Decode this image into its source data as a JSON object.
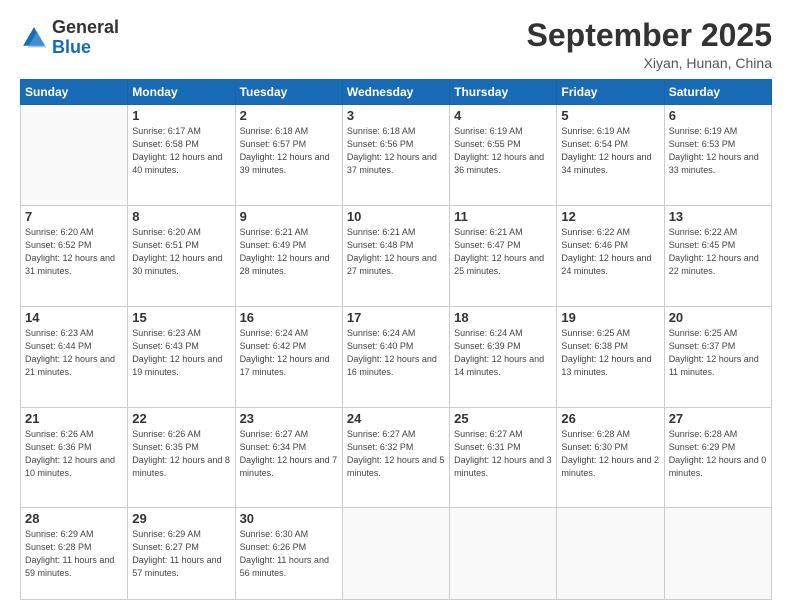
{
  "logo": {
    "general": "General",
    "blue": "Blue"
  },
  "header": {
    "month": "September 2025",
    "location": "Xiyan, Hunan, China"
  },
  "weekdays": [
    "Sunday",
    "Monday",
    "Tuesday",
    "Wednesday",
    "Thursday",
    "Friday",
    "Saturday"
  ],
  "weeks": [
    [
      {
        "day": "",
        "sunrise": "",
        "sunset": "",
        "daylight": ""
      },
      {
        "day": "1",
        "sunrise": "Sunrise: 6:17 AM",
        "sunset": "Sunset: 6:58 PM",
        "daylight": "Daylight: 12 hours and 40 minutes."
      },
      {
        "day": "2",
        "sunrise": "Sunrise: 6:18 AM",
        "sunset": "Sunset: 6:57 PM",
        "daylight": "Daylight: 12 hours and 39 minutes."
      },
      {
        "day": "3",
        "sunrise": "Sunrise: 6:18 AM",
        "sunset": "Sunset: 6:56 PM",
        "daylight": "Daylight: 12 hours and 37 minutes."
      },
      {
        "day": "4",
        "sunrise": "Sunrise: 6:19 AM",
        "sunset": "Sunset: 6:55 PM",
        "daylight": "Daylight: 12 hours and 36 minutes."
      },
      {
        "day": "5",
        "sunrise": "Sunrise: 6:19 AM",
        "sunset": "Sunset: 6:54 PM",
        "daylight": "Daylight: 12 hours and 34 minutes."
      },
      {
        "day": "6",
        "sunrise": "Sunrise: 6:19 AM",
        "sunset": "Sunset: 6:53 PM",
        "daylight": "Daylight: 12 hours and 33 minutes."
      }
    ],
    [
      {
        "day": "7",
        "sunrise": "Sunrise: 6:20 AM",
        "sunset": "Sunset: 6:52 PM",
        "daylight": "Daylight: 12 hours and 31 minutes."
      },
      {
        "day": "8",
        "sunrise": "Sunrise: 6:20 AM",
        "sunset": "Sunset: 6:51 PM",
        "daylight": "Daylight: 12 hours and 30 minutes."
      },
      {
        "day": "9",
        "sunrise": "Sunrise: 6:21 AM",
        "sunset": "Sunset: 6:49 PM",
        "daylight": "Daylight: 12 hours and 28 minutes."
      },
      {
        "day": "10",
        "sunrise": "Sunrise: 6:21 AM",
        "sunset": "Sunset: 6:48 PM",
        "daylight": "Daylight: 12 hours and 27 minutes."
      },
      {
        "day": "11",
        "sunrise": "Sunrise: 6:21 AM",
        "sunset": "Sunset: 6:47 PM",
        "daylight": "Daylight: 12 hours and 25 minutes."
      },
      {
        "day": "12",
        "sunrise": "Sunrise: 6:22 AM",
        "sunset": "Sunset: 6:46 PM",
        "daylight": "Daylight: 12 hours and 24 minutes."
      },
      {
        "day": "13",
        "sunrise": "Sunrise: 6:22 AM",
        "sunset": "Sunset: 6:45 PM",
        "daylight": "Daylight: 12 hours and 22 minutes."
      }
    ],
    [
      {
        "day": "14",
        "sunrise": "Sunrise: 6:23 AM",
        "sunset": "Sunset: 6:44 PM",
        "daylight": "Daylight: 12 hours and 21 minutes."
      },
      {
        "day": "15",
        "sunrise": "Sunrise: 6:23 AM",
        "sunset": "Sunset: 6:43 PM",
        "daylight": "Daylight: 12 hours and 19 minutes."
      },
      {
        "day": "16",
        "sunrise": "Sunrise: 6:24 AM",
        "sunset": "Sunset: 6:42 PM",
        "daylight": "Daylight: 12 hours and 17 minutes."
      },
      {
        "day": "17",
        "sunrise": "Sunrise: 6:24 AM",
        "sunset": "Sunset: 6:40 PM",
        "daylight": "Daylight: 12 hours and 16 minutes."
      },
      {
        "day": "18",
        "sunrise": "Sunrise: 6:24 AM",
        "sunset": "Sunset: 6:39 PM",
        "daylight": "Daylight: 12 hours and 14 minutes."
      },
      {
        "day": "19",
        "sunrise": "Sunrise: 6:25 AM",
        "sunset": "Sunset: 6:38 PM",
        "daylight": "Daylight: 12 hours and 13 minutes."
      },
      {
        "day": "20",
        "sunrise": "Sunrise: 6:25 AM",
        "sunset": "Sunset: 6:37 PM",
        "daylight": "Daylight: 12 hours and 11 minutes."
      }
    ],
    [
      {
        "day": "21",
        "sunrise": "Sunrise: 6:26 AM",
        "sunset": "Sunset: 6:36 PM",
        "daylight": "Daylight: 12 hours and 10 minutes."
      },
      {
        "day": "22",
        "sunrise": "Sunrise: 6:26 AM",
        "sunset": "Sunset: 6:35 PM",
        "daylight": "Daylight: 12 hours and 8 minutes."
      },
      {
        "day": "23",
        "sunrise": "Sunrise: 6:27 AM",
        "sunset": "Sunset: 6:34 PM",
        "daylight": "Daylight: 12 hours and 7 minutes."
      },
      {
        "day": "24",
        "sunrise": "Sunrise: 6:27 AM",
        "sunset": "Sunset: 6:32 PM",
        "daylight": "Daylight: 12 hours and 5 minutes."
      },
      {
        "day": "25",
        "sunrise": "Sunrise: 6:27 AM",
        "sunset": "Sunset: 6:31 PM",
        "daylight": "Daylight: 12 hours and 3 minutes."
      },
      {
        "day": "26",
        "sunrise": "Sunrise: 6:28 AM",
        "sunset": "Sunset: 6:30 PM",
        "daylight": "Daylight: 12 hours and 2 minutes."
      },
      {
        "day": "27",
        "sunrise": "Sunrise: 6:28 AM",
        "sunset": "Sunset: 6:29 PM",
        "daylight": "Daylight: 12 hours and 0 minutes."
      }
    ],
    [
      {
        "day": "28",
        "sunrise": "Sunrise: 6:29 AM",
        "sunset": "Sunset: 6:28 PM",
        "daylight": "Daylight: 11 hours and 59 minutes."
      },
      {
        "day": "29",
        "sunrise": "Sunrise: 6:29 AM",
        "sunset": "Sunset: 6:27 PM",
        "daylight": "Daylight: 11 hours and 57 minutes."
      },
      {
        "day": "30",
        "sunrise": "Sunrise: 6:30 AM",
        "sunset": "Sunset: 6:26 PM",
        "daylight": "Daylight: 11 hours and 56 minutes."
      },
      {
        "day": "",
        "sunrise": "",
        "sunset": "",
        "daylight": ""
      },
      {
        "day": "",
        "sunrise": "",
        "sunset": "",
        "daylight": ""
      },
      {
        "day": "",
        "sunrise": "",
        "sunset": "",
        "daylight": ""
      },
      {
        "day": "",
        "sunrise": "",
        "sunset": "",
        "daylight": ""
      }
    ]
  ]
}
